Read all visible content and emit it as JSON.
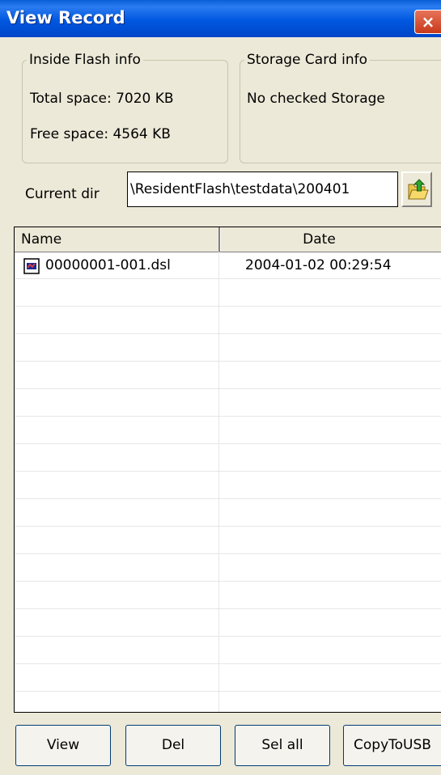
{
  "window": {
    "title": "View Record",
    "close_label": "×"
  },
  "inside_flash": {
    "label": "Inside Flash info",
    "total": "Total space: 7020 KB",
    "free": "Free space: 4564 KB"
  },
  "storage_card": {
    "label": "Storage Card info",
    "status": "No checked Storage"
  },
  "current_dir": {
    "label": "Current dir",
    "value": "\\ResidentFlash\\testdata\\200401"
  },
  "file_list": {
    "columns": [
      "Name",
      "Date"
    ],
    "rows": [
      {
        "name": "00000001-001.dsl",
        "date": "2004-01-02 00:29:54"
      }
    ]
  },
  "buttons": {
    "view": "View",
    "del": "Del",
    "sel_all": "Sel all",
    "copy_to_usb": "CopyToUSB"
  },
  "icons": {
    "close": "close-icon",
    "folder_up": "folder-up-icon",
    "file": "file-icon"
  }
}
